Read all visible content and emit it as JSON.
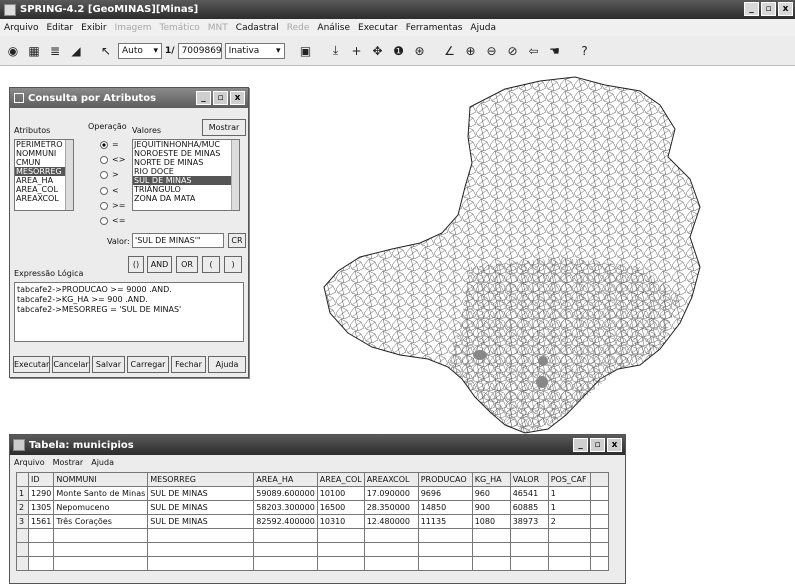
{
  "window": {
    "title": "SPRING-4.2 [GeoMINAS][Minas]",
    "buttons": [
      "_",
      "▫",
      "x"
    ]
  },
  "menu": {
    "items": [
      {
        "label": "Arquivo",
        "enabled": true
      },
      {
        "label": "Editar",
        "enabled": true
      },
      {
        "label": "Exibir",
        "enabled": true
      },
      {
        "label": "Imagem",
        "enabled": false
      },
      {
        "label": "Temático",
        "enabled": false
      },
      {
        "label": "MNT",
        "enabled": false
      },
      {
        "label": "Cadastral",
        "enabled": true
      },
      {
        "label": "Rede",
        "enabled": false
      },
      {
        "label": "Análise",
        "enabled": true
      },
      {
        "label": "Executar",
        "enabled": true
      },
      {
        "label": "Ferramentas",
        "enabled": true
      },
      {
        "label": "Ajuda",
        "enabled": true
      }
    ]
  },
  "toolbar": {
    "zoom_mode": "Auto",
    "scale_prefix": "1/",
    "scale_value": "7009869",
    "state": "Inativa"
  },
  "query_dialog": {
    "title": "Consulta por Atributos",
    "attributes_label": "Atributos",
    "operation_label": "Operação",
    "values_label": "Valores",
    "show_button": "Mostrar",
    "attributes": [
      "PERIMETRO",
      "NOMMUNI",
      "CMUN",
      "MESORREG",
      "AREA_HA",
      "AREA_COL",
      "AREAXCOL"
    ],
    "attributes_selected": 3,
    "operators": [
      "=",
      "<>",
      ">",
      "<",
      ">=",
      "<="
    ],
    "operator_selected": 0,
    "values": [
      "JEQUITINHONHA/MUC",
      "NOROESTE DE MINAS",
      "NORTE DE MINAS",
      "RIO DOCE",
      "SUL DE MINAS",
      "TRIÂNGULO",
      "ZONA DA MATA"
    ],
    "values_selected": 4,
    "value_label": "Valor:",
    "value_input": "'SUL DE MINAS'\"",
    "cr_button": "CR",
    "logic_buttons": [
      "()",
      "AND",
      "OR",
      "(",
      ")"
    ],
    "expression_label": "Expressão Lógica",
    "expression_lines": [
      "tabcafe2->PRODUCAO >= 9000 .AND.",
      "tabcafe2->KG_HA >= 900 .AND.",
      "tabcafe2->MESORREG = 'SUL DE MINAS'"
    ],
    "actions": [
      "Executar",
      "Cancelar",
      "Salvar",
      "Carregar",
      "Fechar",
      "Ajuda"
    ]
  },
  "table_window": {
    "title": "Tabela: municipios",
    "menu": [
      "Arquivo",
      "Mostrar",
      "Ajuda"
    ],
    "columns": [
      "",
      "ID",
      "NOMMUNI",
      "MESORREG",
      "AREA_HA",
      "AREA_COL",
      "AREAXCOL",
      "PRODUCAO",
      "KG_HA",
      "VALOR",
      "POS_CAF",
      ""
    ],
    "rows": [
      [
        "1",
        "1290",
        "Monte Santo de Minas",
        "SUL DE MINAS",
        "59089.600000",
        "10100",
        "17.090000",
        "9696",
        "960",
        "46541",
        "1",
        ""
      ],
      [
        "2",
        "1305",
        "Nepomuceno",
        "SUL DE MINAS",
        "58203.300000",
        "16500",
        "28.350000",
        "14850",
        "900",
        "60885",
        "1",
        ""
      ],
      [
        "3",
        "1561",
        "Três Corações",
        "SUL DE MINAS",
        "82592.400000",
        "10310",
        "12.480000",
        "11135",
        "1080",
        "38973",
        "2",
        ""
      ]
    ],
    "empty_rows": 3
  },
  "colors": {
    "title_dark": "#2c2c2c",
    "dialog_bg": "#ececec",
    "selection": "#555555"
  }
}
